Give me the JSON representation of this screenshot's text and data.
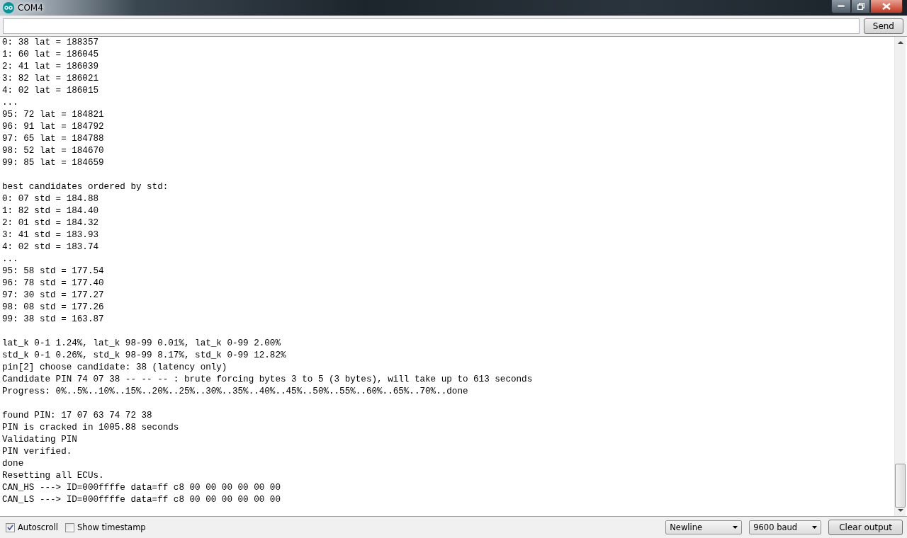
{
  "window": {
    "title": "COM4"
  },
  "send_button": "Send",
  "output_blocks": [
    [
      "0: 38 lat = 188357",
      "1: 60 lat = 186045",
      "2: 41 lat = 186039",
      "3: 82 lat = 186021",
      "4: 02 lat = 186015",
      "...",
      "95: 72 lat = 184821",
      "96: 91 lat = 184792",
      "97: 65 lat = 184788",
      "98: 52 lat = 184670",
      "99: 85 lat = 184659"
    ],
    [
      "best candidates ordered by std:",
      "0: 07 std = 184.88",
      "1: 82 std = 184.40",
      "2: 01 std = 184.32",
      "3: 41 std = 183.93",
      "4: 02 std = 183.74",
      "...",
      "95: 58 std = 177.54",
      "96: 78 std = 177.40",
      "97: 30 std = 177.27",
      "98: 08 std = 177.26",
      "99: 38 std = 163.87"
    ],
    [
      "lat_k 0-1 1.24%, lat_k 98-99 0.01%, lat_k 0-99 2.00%",
      "std_k 0-1 0.26%, std_k 98-99 8.17%, std_k 0-99 12.82%",
      "pin[2] choose candidate: 38 (latency only)",
      "Candidate PIN 74 07 38 -- -- -- : brute forcing bytes 3 to 5 (3 bytes), will take up to 613 seconds",
      "Progress: 0%..5%..10%..15%..20%..25%..30%..35%..40%..45%..50%..55%..60%..65%..70%..done"
    ],
    [
      "found PIN: 17 07 63 74 72 38",
      "PIN is cracked in 1005.88 seconds",
      "Validating PIN",
      "PIN verified.",
      "done",
      "Resetting all ECUs.",
      "CAN_HS ---> ID=000ffffe data=ff c8 00 00 00 00 00 00",
      "CAN_LS ---> ID=000ffffe data=ff c8 00 00 00 00 00 00"
    ]
  ],
  "status_bar": {
    "checkboxes": [
      {
        "label": "Autoscroll",
        "checked": true
      },
      {
        "label": "Show timestamp",
        "checked": false
      }
    ],
    "dropdowns": [
      {
        "value": "Newline"
      },
      {
        "value": "9600 baud"
      }
    ],
    "clear_button": "Clear output"
  }
}
